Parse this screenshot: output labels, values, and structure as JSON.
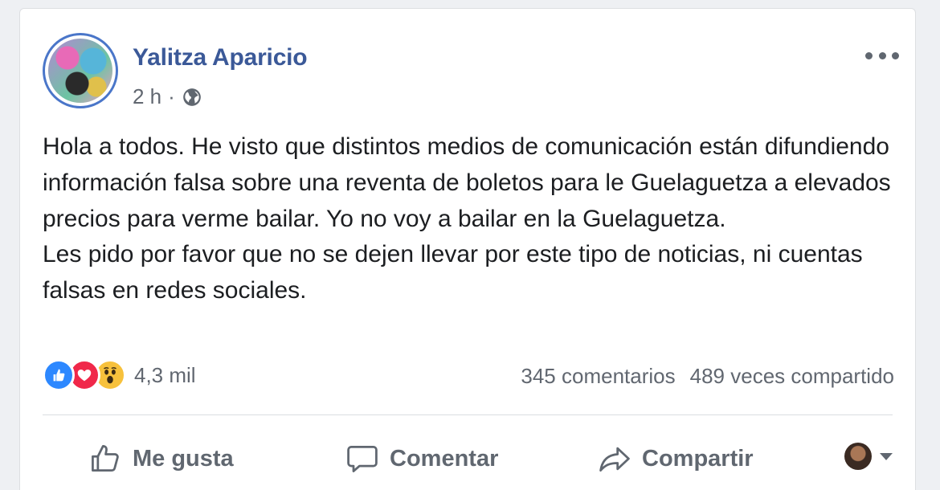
{
  "post": {
    "author": "Yalitza Aparicio",
    "time": "2 h",
    "separator": "·",
    "audience_icon": "globe-icon",
    "body": [
      "Hola a todos. He visto que distintos medios de comunicación están difundiendo información falsa sobre una reventa de boletos para le Guelaguetza a elevados precios para verme bailar. Yo no voy a bailar en la Guelaguetza.",
      "Les pido por favor que no se dejen llevar por este tipo de noticias, ni cuentas falsas en redes sociales."
    ],
    "reactions": {
      "types": [
        "like",
        "love",
        "wow"
      ],
      "count": "4,3 mil"
    },
    "comments": "345 comentarios",
    "shares": "489 veces compartido"
  },
  "actions": {
    "like": "Me gusta",
    "comment": "Comentar",
    "share": "Compartir"
  },
  "colors": {
    "author": "#3b5998",
    "muted": "#616770",
    "like": "#2d88ff",
    "love": "#f0284a",
    "wow": "#f7c13c"
  }
}
